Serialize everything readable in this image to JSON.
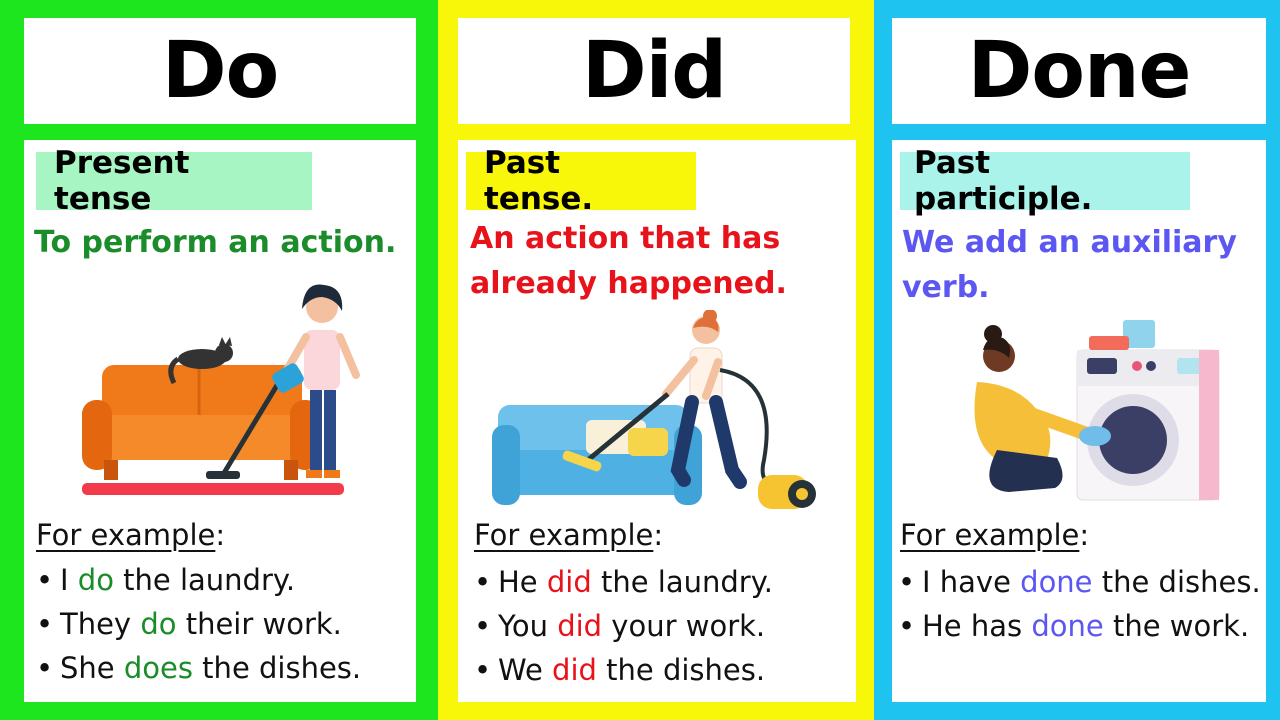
{
  "columns": [
    {
      "title": "Do",
      "tag": "Present tense",
      "description": [
        "To perform an action."
      ],
      "example_heading": "For example",
      "examples": [
        {
          "pre": "I ",
          "verb": "do",
          "post": " the laundry."
        },
        {
          "pre": "They ",
          "verb": "do",
          "post": " their work."
        },
        {
          "pre": "She ",
          "verb": "does",
          "post": " the dishes."
        }
      ],
      "colors": {
        "border": "#1ee61e",
        "tag_bg": "#a8f5c4",
        "accent": "#1a8c2a"
      },
      "illustration": "woman-vacuuming-orange-sofa-with-cat"
    },
    {
      "title": "Did",
      "tag": "Past tense.",
      "description": [
        "An action that has",
        "already happened."
      ],
      "example_heading": "For example",
      "examples": [
        {
          "pre": "He ",
          "verb": "did",
          "post": " the laundry."
        },
        {
          "pre": "You ",
          "verb": "did",
          "post": " your work."
        },
        {
          "pre": "We ",
          "verb": "did",
          "post": " the dishes."
        }
      ],
      "colors": {
        "border": "#f8f70a",
        "tag_bg": "#f8f70a",
        "accent": "#e8121b"
      },
      "illustration": "woman-vacuuming-blue-sofa"
    },
    {
      "title": "Done",
      "tag": "Past participle.",
      "description": [
        "We add an auxiliary",
        "verb."
      ],
      "example_heading": "For example",
      "examples": [
        {
          "pre": "I have ",
          "verb": "done",
          "post": " the dishes."
        },
        {
          "pre": "He has ",
          "verb": "done",
          "post": " the work."
        }
      ],
      "colors": {
        "border": "#1ec3f0",
        "tag_bg": "#a9f3ea",
        "accent": "#5b57f0"
      },
      "illustration": "woman-loading-washing-machine"
    }
  ]
}
